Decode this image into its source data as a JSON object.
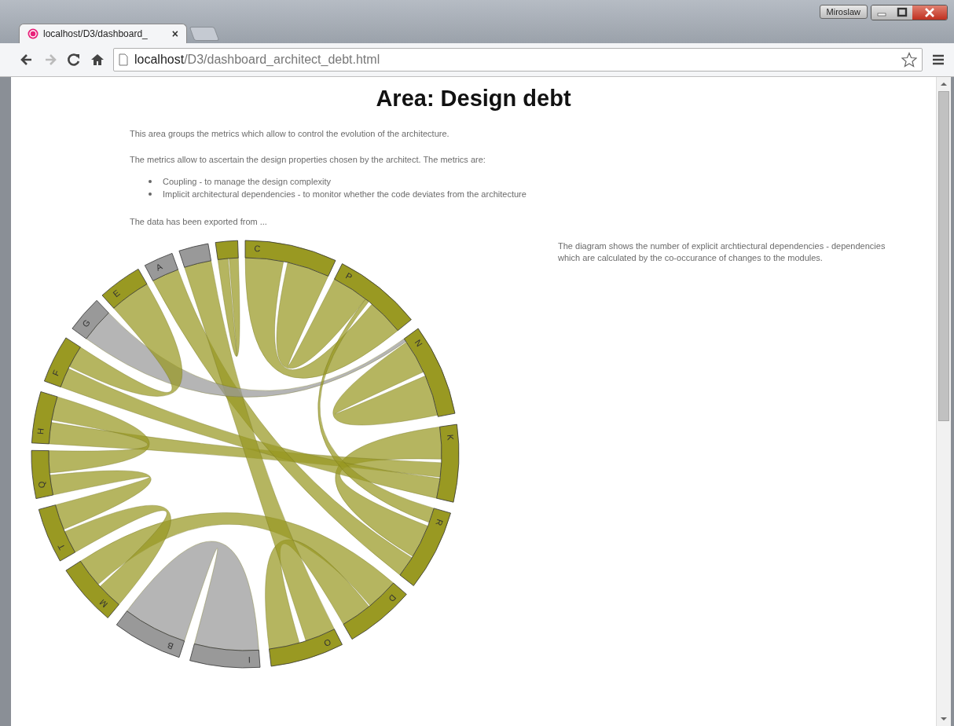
{
  "window": {
    "user": "Miroslaw"
  },
  "tabs": [
    {
      "title": "localhost/D3/dashboard_",
      "selected": true,
      "close": "×"
    }
  ],
  "address": {
    "host": "localhost",
    "path": "/D3/dashboard_architect_debt.html"
  },
  "page": {
    "title": "Area: Design debt",
    "intro": [
      "This area groups the metrics which allow to control the evolution of the architecture.",
      "The metrics allow to ascertain the design properties chosen by the architect. The metrics are:"
    ],
    "bullets": [
      "Coupling - to manage the design complexity",
      "Implicit architectural dependencies - to monitor whether the code deviates from the architecture"
    ],
    "note": "The data has been exported from ...",
    "diagram_text": "The diagram shows the number of explicit archtiectural dependencies - dependencies which are calculated by the co-occurance of changes to the modules.",
    "diagram": {
      "groups": [
        {
          "label": "C",
          "color": "#999922"
        },
        {
          "label": "P",
          "color": "#999922"
        },
        {
          "label": "N",
          "color": "#999922"
        },
        {
          "label": "K",
          "color": "#999922"
        },
        {
          "label": "R",
          "color": "#999922"
        },
        {
          "label": "D",
          "color": "#999922"
        },
        {
          "label": "O",
          "color": "#999922"
        },
        {
          "label": "I",
          "color": "#999999"
        },
        {
          "label": "B",
          "color": "#999999"
        },
        {
          "label": "M",
          "color": "#999922"
        },
        {
          "label": "T",
          "color": "#999922"
        },
        {
          "label": "Q",
          "color": "#999922"
        },
        {
          "label": "H",
          "color": "#999922"
        },
        {
          "label": "F",
          "color": "#999922"
        },
        {
          "label": "G",
          "color": "#999999"
        },
        {
          "label": "E",
          "color": "#999922"
        },
        {
          "label": "A",
          "color": "#999999"
        },
        {
          "color": "#999999"
        },
        {
          "color": "#999922"
        }
      ]
    }
  }
}
